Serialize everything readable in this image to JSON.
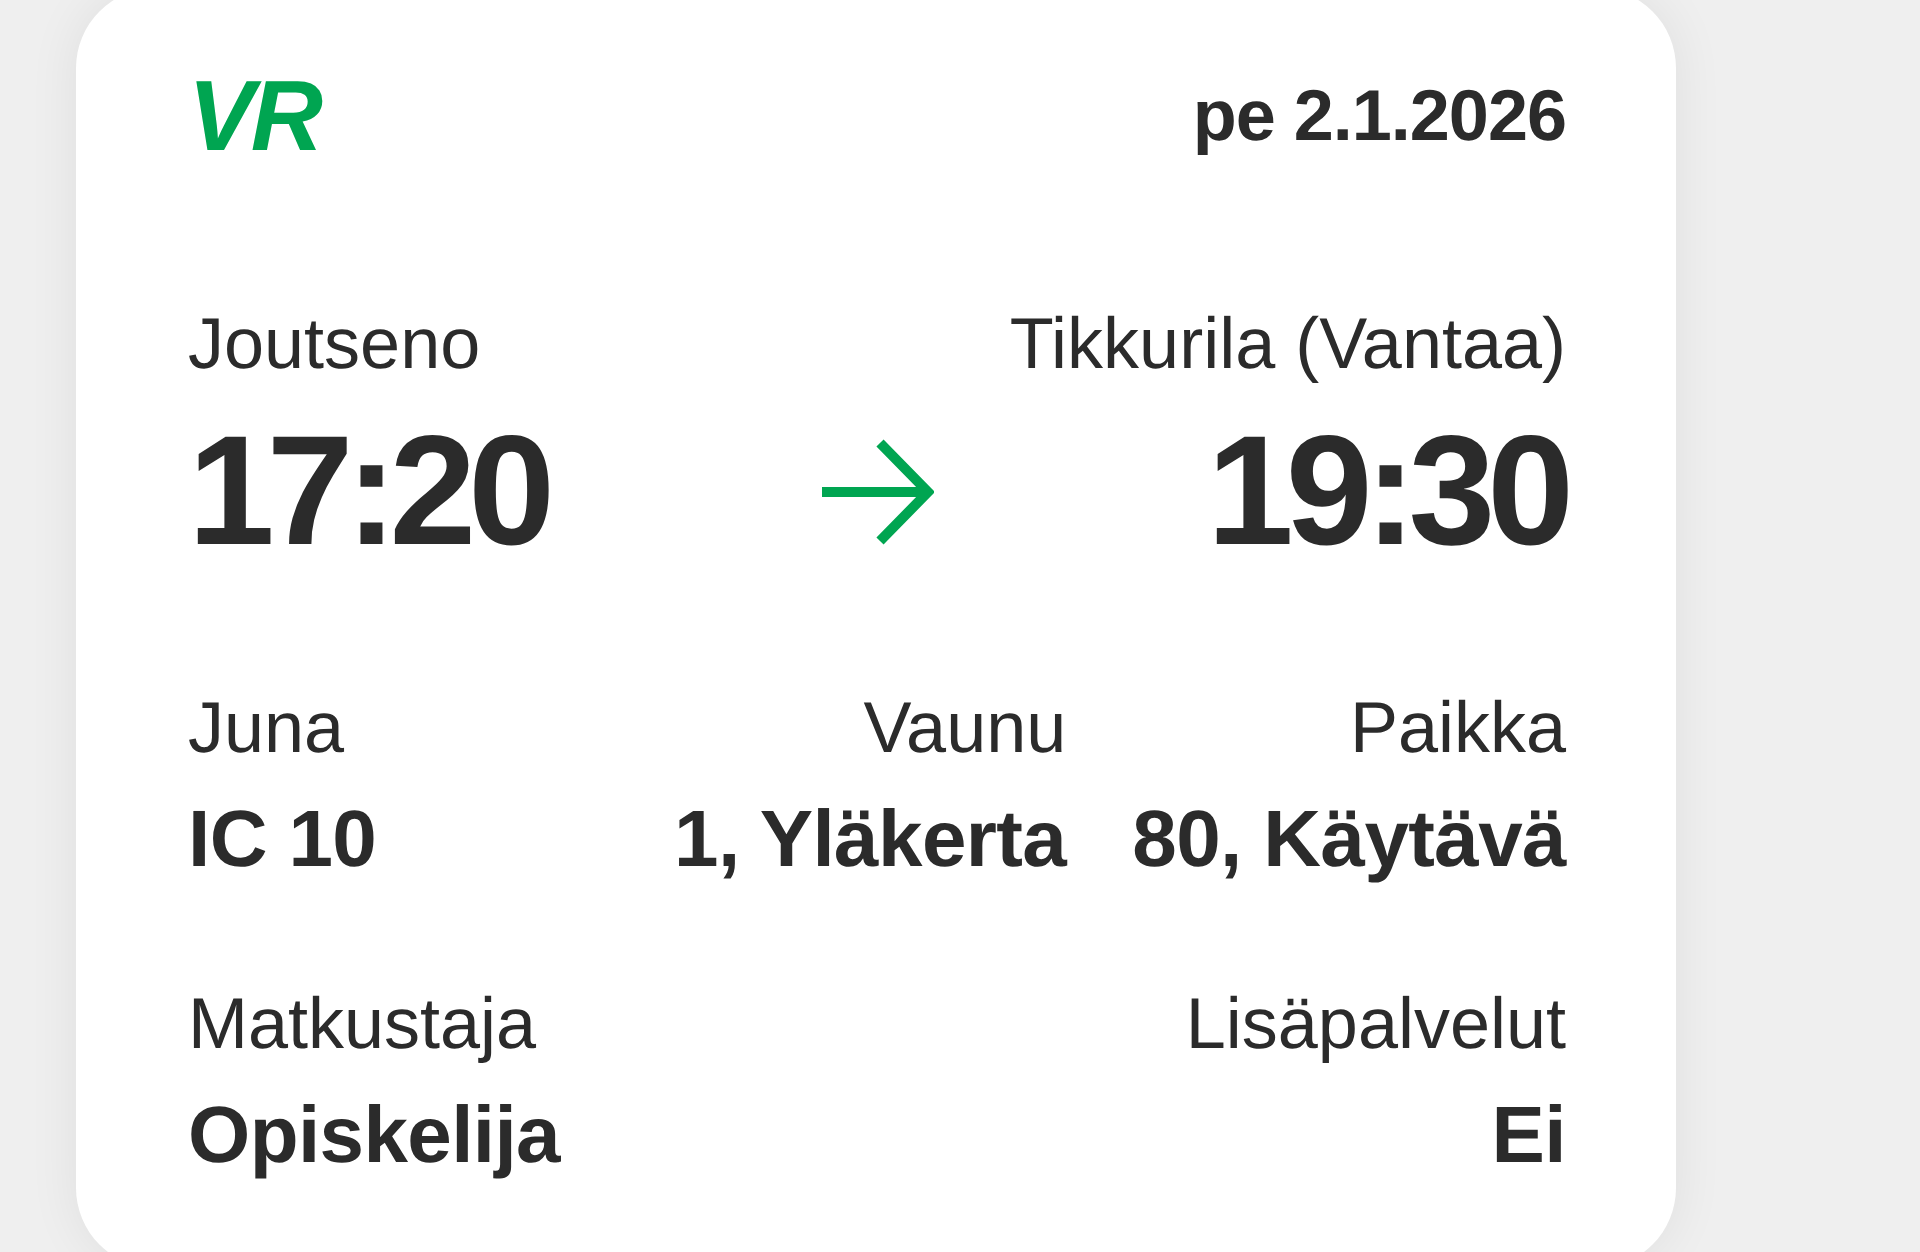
{
  "header": {
    "logo": "VR",
    "date": "pe 2.1.2026"
  },
  "journey": {
    "departure": {
      "station": "Joutseno",
      "time": "17:20"
    },
    "arrival": {
      "station": "Tikkurila (Vantaa)",
      "time": "19:30"
    }
  },
  "details": [
    {
      "label": "Juna",
      "value": "IC 10"
    },
    {
      "label": "Vaunu",
      "value": "1, Yläkerta"
    },
    {
      "label": "Paikka",
      "value": "80, Käytävä"
    }
  ],
  "passenger": [
    {
      "label": "Matkustaja",
      "value": "Opiskelija"
    },
    {
      "label": "Lisäpalvelut",
      "value": "Ei"
    }
  ]
}
